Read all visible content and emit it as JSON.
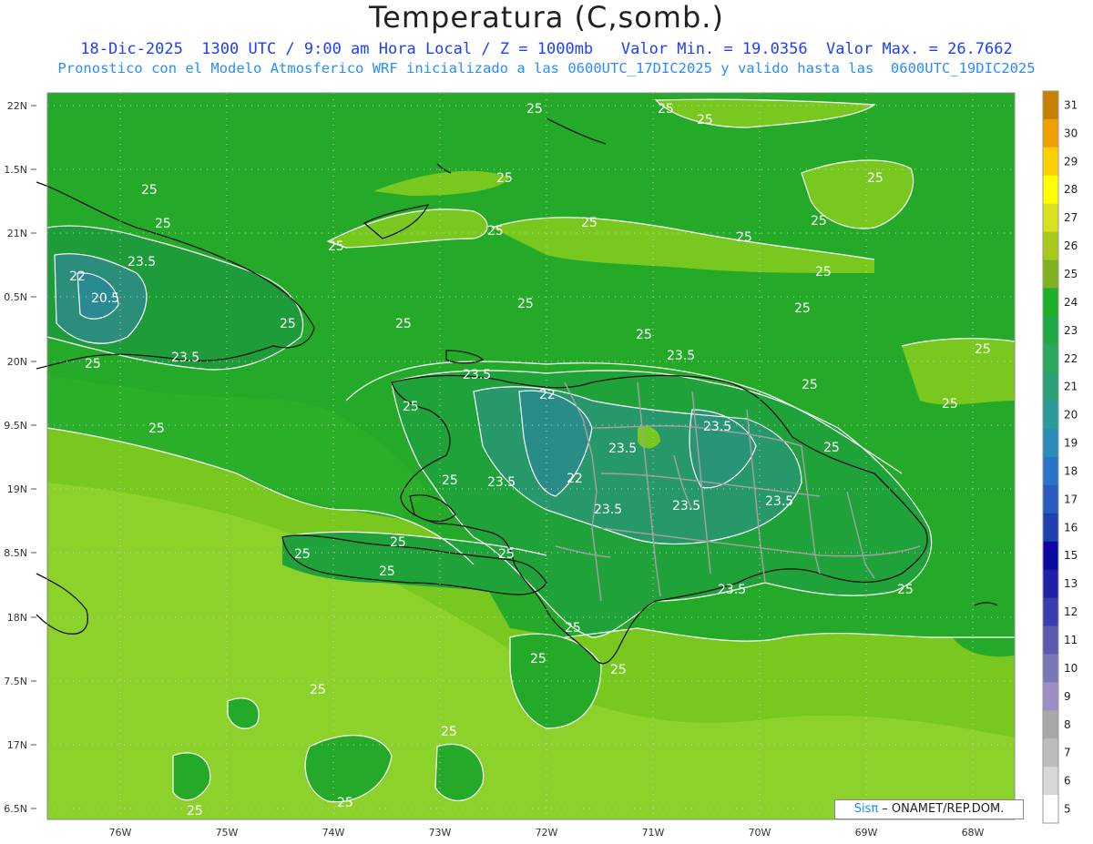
{
  "header": {
    "title": "Temperatura (C,somb.)",
    "line1": "18-Dic-2025  1300 UTC / 9:00 am Hora Local / Z = 1000mb   Valor Min. = 19.0356  Valor Max. = 26.7662",
    "line2": "Pronostico con el Modelo Atmosferico WRF inicializado a las 0600UTC_17DIC2025 y valido hasta las  0600UTC_19DIC2025"
  },
  "axes": {
    "lat_labels": [
      "22N",
      "1.5N",
      "21N",
      "0.5N",
      "20N",
      "9.5N",
      "19N",
      "8.5N",
      "18N",
      "7.5N",
      "17N",
      "6.5N"
    ],
    "lon_labels": [
      "76W",
      "75W",
      "74W",
      "73W",
      "72W",
      "71W",
      "70W",
      "69W",
      "68W"
    ]
  },
  "colorbar": {
    "labels": [
      "5",
      "6",
      "7",
      "8",
      "9",
      "10",
      "11",
      "12",
      "13",
      "15",
      "16",
      "17",
      "18",
      "19",
      "20",
      "21",
      "22",
      "23",
      "24",
      "25",
      "26",
      "27",
      "28",
      "29",
      "30",
      "31"
    ],
    "colors": [
      "#ffffff",
      "#d8d8d8",
      "#bcbcbc",
      "#a8a8a8",
      "#9a8ec4",
      "#7878b8",
      "#5a5ab0",
      "#3c3cae",
      "#1e1ea8",
      "#0a0aa0",
      "#1f3fb0",
      "#2a5cc0",
      "#2a74c8",
      "#2a8cb8",
      "#2a9a9a",
      "#2aa078",
      "#2aa860",
      "#1ea846",
      "#1cb028",
      "#80b020",
      "#a8c81c",
      "#d8e020",
      "#ffff00",
      "#ffd000",
      "#f0a000",
      "#c88000"
    ]
  },
  "contour_labels": [
    "25",
    "23.5",
    "22",
    "20.5"
  ],
  "credit": {
    "brand": "Sisπ",
    "org": " – ONAMET/REP.DOM."
  }
}
